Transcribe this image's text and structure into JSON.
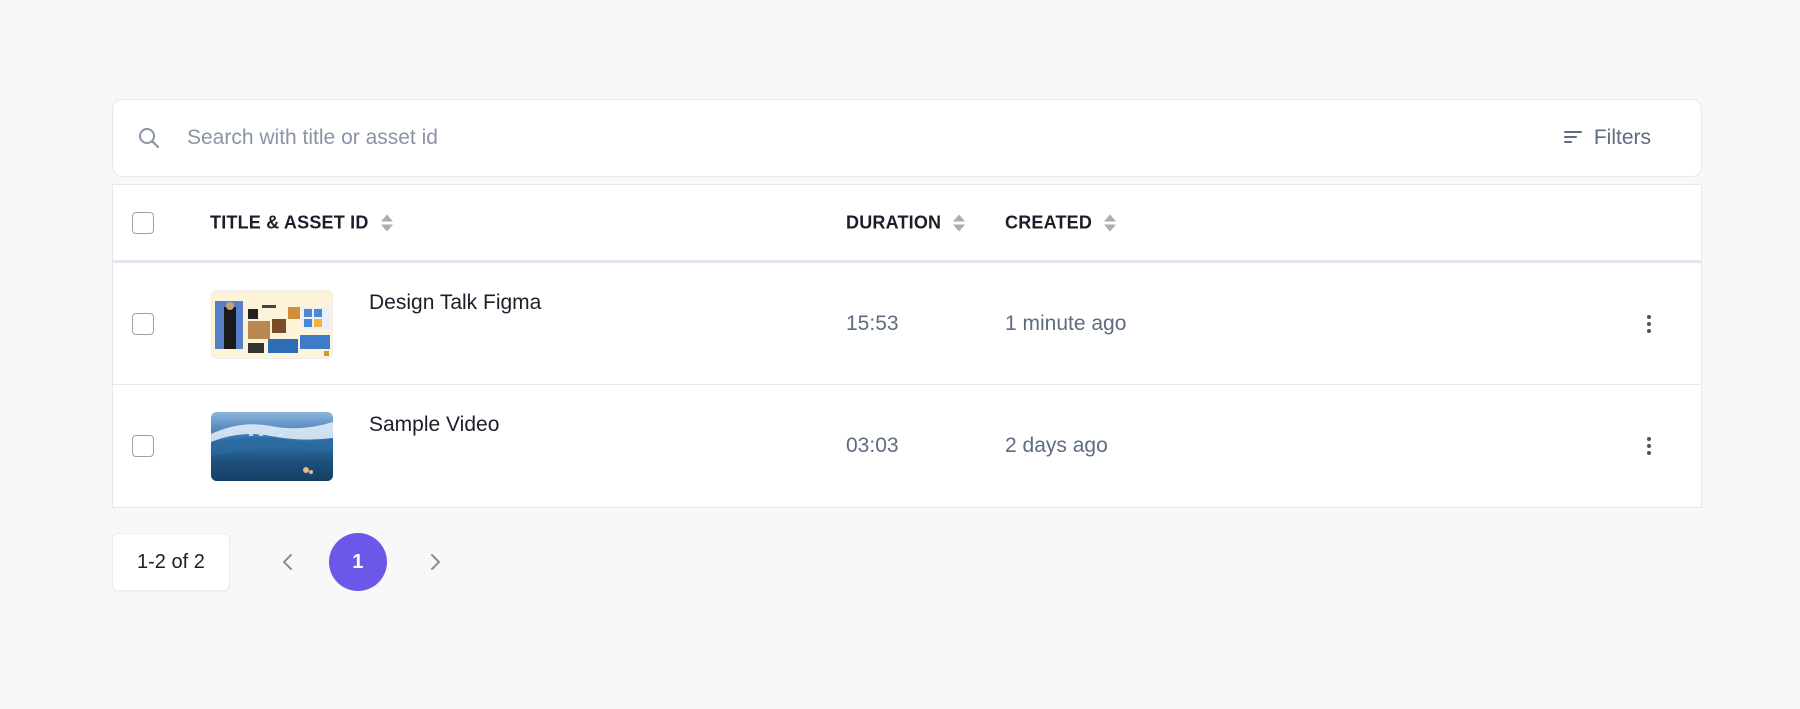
{
  "search": {
    "placeholder": "Search with title or asset id",
    "filters_label": "Filters"
  },
  "table": {
    "columns": [
      {
        "label": "TITLE & ASSET ID"
      },
      {
        "label": "DURATION"
      },
      {
        "label": "CREATED"
      }
    ],
    "rows": [
      {
        "title": "Design Talk Figma",
        "duration": "15:53",
        "created": "1 minute ago"
      },
      {
        "title": "Sample Video",
        "duration": "03:03",
        "created": "2 days ago"
      }
    ]
  },
  "pagination": {
    "range": "1-2 of 2",
    "current_page": "1"
  },
  "colors": {
    "accent": "#6b57e8",
    "muted_text": "#5e6b80",
    "placeholder": "#8a94a6"
  }
}
